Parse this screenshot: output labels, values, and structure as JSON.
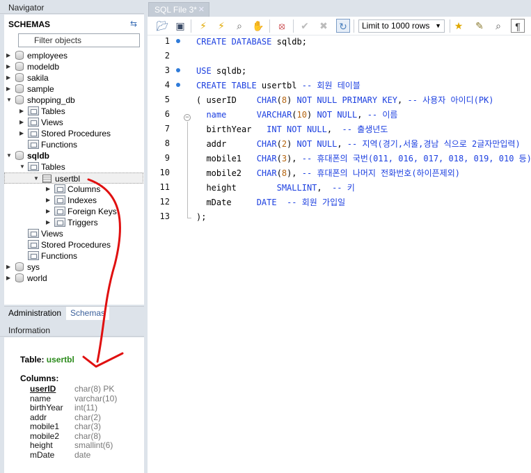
{
  "navigator": {
    "title": "Navigator",
    "schemas_label": "SCHEMAS",
    "filter_placeholder": "Filter objects",
    "tree": {
      "employees": "employees",
      "modeldb": "modeldb",
      "sakila": "sakila",
      "sample": "sample",
      "shopping_db": "shopping_db",
      "shopping_tables": "Tables",
      "shopping_views": "Views",
      "shopping_procs": "Stored Procedures",
      "shopping_funcs": "Functions",
      "sqldb": "sqldb",
      "sqldb_tables": "Tables",
      "usertbl": "usertbl",
      "columns": "Columns",
      "indexes": "Indexes",
      "foreign_keys": "Foreign Keys",
      "triggers": "Triggers",
      "sqldb_views": "Views",
      "sqldb_procs": "Stored Procedures",
      "sqldb_funcs": "Functions",
      "sys": "sys",
      "world": "world"
    }
  },
  "bottom_tabs": {
    "administration": "Administration",
    "schemas": "Schemas"
  },
  "information": {
    "title": "Information",
    "table_prefix": "Table:",
    "table_name": "usertbl",
    "columns_label": "Columns:",
    "columns": [
      {
        "name": "userID",
        "type": "char(8) PK"
      },
      {
        "name": "name",
        "type": "varchar(10)"
      },
      {
        "name": "birthYear",
        "type": "int(11)"
      },
      {
        "name": "addr",
        "type": "char(2)"
      },
      {
        "name": "mobile1",
        "type": "char(3)"
      },
      {
        "name": "mobile2",
        "type": "char(8)"
      },
      {
        "name": "height",
        "type": "smallint(6)"
      },
      {
        "name": "mDate",
        "type": "date"
      }
    ]
  },
  "editor": {
    "tab_label": "SQL File 3*",
    "limit_label": "Limit to 1000 rows",
    "line_numbers": [
      "1",
      "2",
      "3",
      "4",
      "5",
      "6",
      "7",
      "8",
      "9",
      "10",
      "11",
      "12",
      "13"
    ],
    "colors": {
      "keyword": "#1d40e0",
      "number": "#b46410",
      "marker": "#2f7bd9",
      "annotation_arrow": "#e01010",
      "table_green": "#2a8a1a"
    }
  },
  "icons": [
    "open-folder-icon",
    "save-icon",
    "execute-icon",
    "execute-current-icon",
    "explain-icon",
    "stop-icon",
    "toggle-error-icon",
    "commit-icon",
    "rollback-icon",
    "autocommit-icon",
    "add-snippet-icon",
    "beautify-icon",
    "find-icon",
    "invisible-chars-icon",
    "refresh-icon"
  ]
}
